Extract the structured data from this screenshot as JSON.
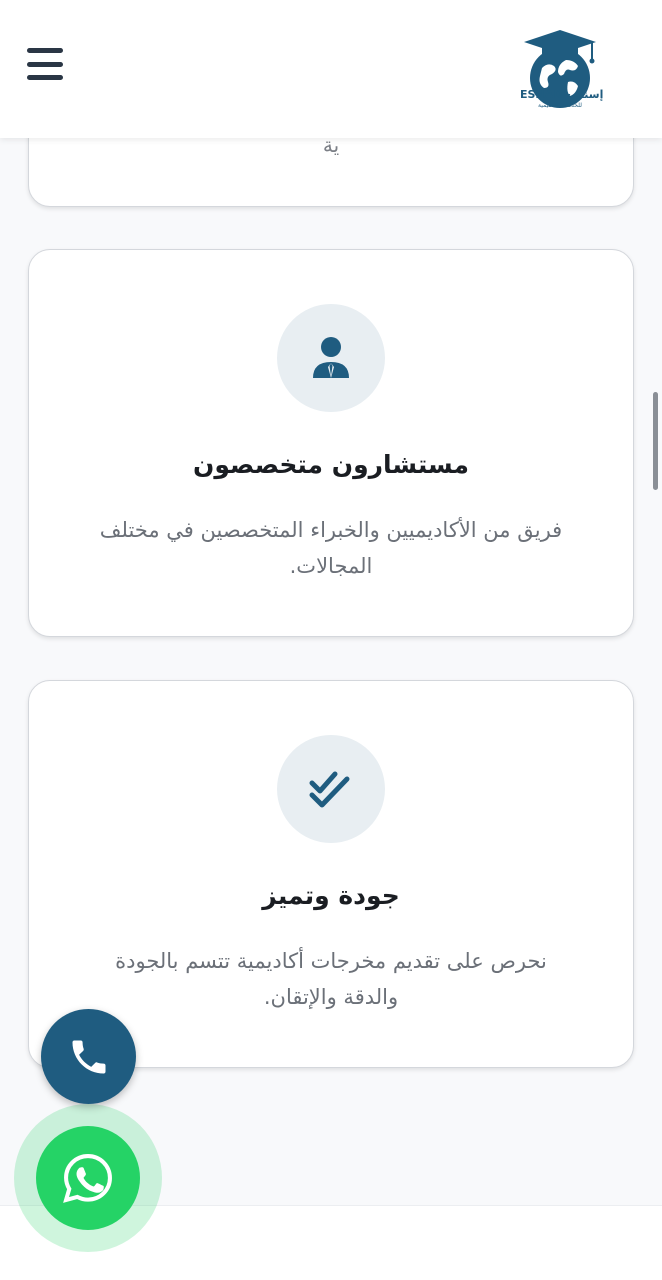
{
  "header": {
    "menu_icon": "hamburger-menu-icon",
    "logo_name": "ESNAD - إسناد",
    "logo_subtitle": "للخدمات التعليمية",
    "brand_color": "#1f5c80"
  },
  "cards": {
    "top_partial": {
      "cut_text": "ية"
    },
    "advisors": {
      "icon": "user-tie-icon",
      "title": "مستشارون متخصصون",
      "description": "فريق من الأكاديميين والخبراء المتخصصين في مختلف المجالات."
    },
    "quality": {
      "icon": "double-check-icon",
      "title": "جودة وتميز",
      "description": "نحرص على تقديم مخرجات أكاديمية تتسم بالجودة والدقة والإتقان."
    }
  },
  "floating": {
    "phone_icon": "phone-icon",
    "phone_color": "#1f5c80",
    "whatsapp_icon": "whatsapp-icon",
    "whatsapp_color": "#25d366"
  }
}
